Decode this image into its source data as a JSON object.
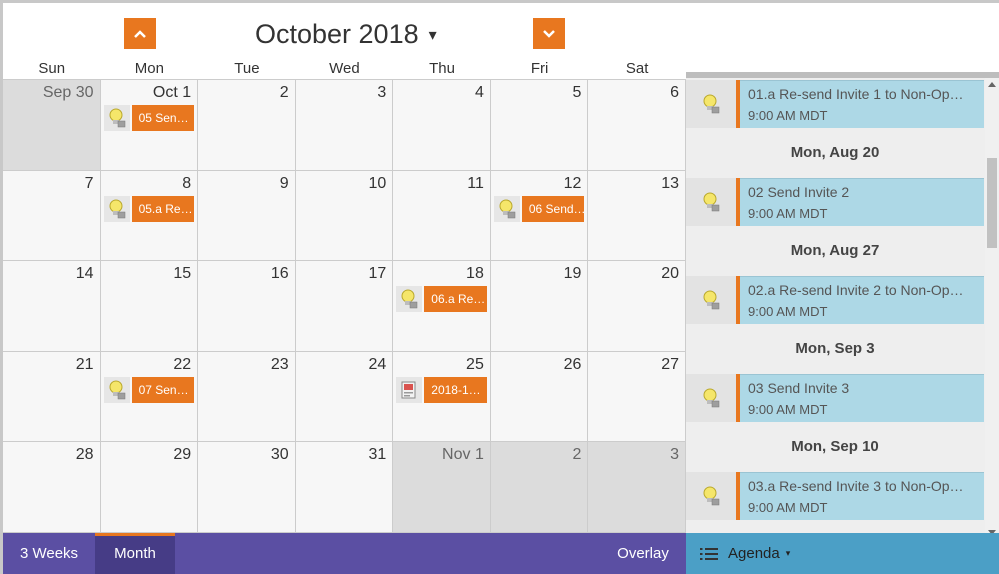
{
  "calendar": {
    "title": "October 2018",
    "title_caret": "▾",
    "days_of_week": [
      "Sun",
      "Mon",
      "Tue",
      "Wed",
      "Thu",
      "Fri",
      "Sat"
    ],
    "weeks": [
      [
        {
          "num": "Sep 30",
          "other": true
        },
        {
          "num": "Oct 1",
          "other": false,
          "event": {
            "label": "05 Sen…",
            "icon": "lightbulb-icon"
          }
        },
        {
          "num": "2",
          "other": false
        },
        {
          "num": "3",
          "other": false
        },
        {
          "num": "4",
          "other": false
        },
        {
          "num": "5",
          "other": false
        },
        {
          "num": "6",
          "other": false
        }
      ],
      [
        {
          "num": "7",
          "other": false
        },
        {
          "num": "8",
          "other": false,
          "event": {
            "label": "05.a Re…",
            "icon": "lightbulb-icon"
          }
        },
        {
          "num": "9",
          "other": false
        },
        {
          "num": "10",
          "other": false
        },
        {
          "num": "11",
          "other": false
        },
        {
          "num": "12",
          "other": false,
          "event": {
            "label": "06 Send…",
            "icon": "lightbulb-icon"
          }
        },
        {
          "num": "13",
          "other": false
        }
      ],
      [
        {
          "num": "14",
          "other": false
        },
        {
          "num": "15",
          "other": false
        },
        {
          "num": "16",
          "other": false
        },
        {
          "num": "17",
          "other": false
        },
        {
          "num": "18",
          "other": false,
          "event": {
            "label": "06.a Re…",
            "icon": "lightbulb-icon"
          }
        },
        {
          "num": "19",
          "other": false
        },
        {
          "num": "20",
          "other": false
        }
      ],
      [
        {
          "num": "21",
          "other": false
        },
        {
          "num": "22",
          "other": false,
          "event": {
            "label": "07 Sen…",
            "icon": "lightbulb-icon"
          }
        },
        {
          "num": "23",
          "other": false
        },
        {
          "num": "24",
          "other": false
        },
        {
          "num": "25",
          "other": false,
          "event": {
            "label": "2018-1…",
            "icon": "report-icon"
          }
        },
        {
          "num": "26",
          "other": false
        },
        {
          "num": "27",
          "other": false
        }
      ],
      [
        {
          "num": "28",
          "other": false
        },
        {
          "num": "29",
          "other": false
        },
        {
          "num": "30",
          "other": false
        },
        {
          "num": "31",
          "other": false
        },
        {
          "num": "Nov 1",
          "other": true
        },
        {
          "num": "2",
          "other": true
        },
        {
          "num": "3",
          "other": true
        }
      ]
    ]
  },
  "agenda": {
    "entries": [
      {
        "kind": "item",
        "title": "01.a Re-send Invite 1 to Non-Op…",
        "time": "9:00 AM MDT",
        "icon": "lightbulb-icon"
      },
      {
        "kind": "date",
        "label": "Mon, Aug 20"
      },
      {
        "kind": "item",
        "title": "02 Send Invite 2",
        "time": "9:00 AM MDT",
        "icon": "lightbulb-icon"
      },
      {
        "kind": "date",
        "label": "Mon, Aug 27"
      },
      {
        "kind": "item",
        "title": "02.a Re-send Invite 2 to Non-Op…",
        "time": "9:00 AM MDT",
        "icon": "lightbulb-icon"
      },
      {
        "kind": "date",
        "label": "Mon, Sep 3"
      },
      {
        "kind": "item",
        "title": "03 Send Invite 3",
        "time": "9:00 AM MDT",
        "icon": "lightbulb-icon"
      },
      {
        "kind": "date",
        "label": "Mon, Sep 10"
      },
      {
        "kind": "item",
        "title": "03.a Re-send Invite 3 to Non-Op…",
        "time": "9:00 AM MDT",
        "icon": "lightbulb-icon"
      }
    ]
  },
  "bottom_bar": {
    "view_3weeks": "3 Weeks",
    "view_month": "Month",
    "overlay": "Overlay",
    "agenda_label": "Agenda",
    "agenda_caret": "▾"
  },
  "colors": {
    "accent_orange": "#e8771f",
    "bottom_purple": "#5b4fa3",
    "agenda_blue": "#4b9fc6",
    "agenda_item_bg": "#add8e6"
  }
}
